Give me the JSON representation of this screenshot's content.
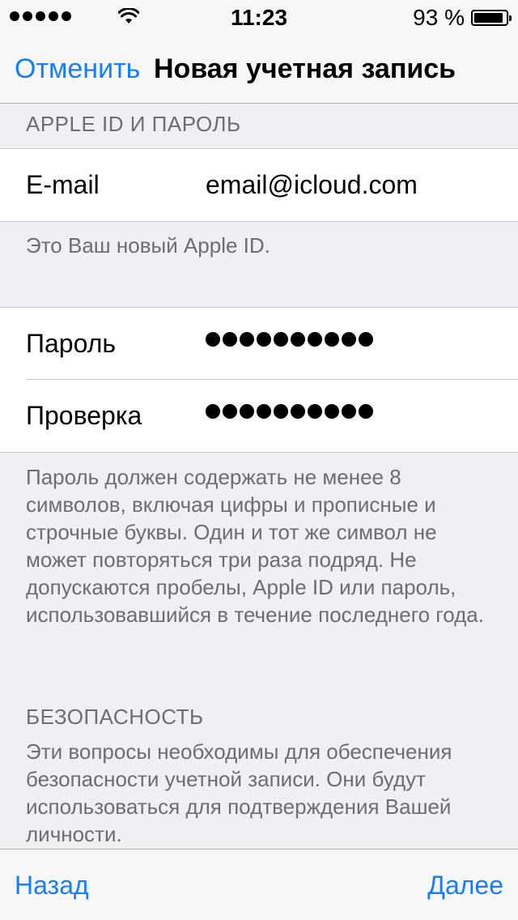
{
  "status_bar": {
    "time": "11:23",
    "battery_percent": "93 %",
    "battery_level": 0.93
  },
  "nav": {
    "cancel_label": "Отменить",
    "title": "Новая учетная запись"
  },
  "sections": {
    "apple_id_header": "APPLE ID И ПАРОЛЬ",
    "email_label": "E-mail",
    "email_value": "email@icloud.com",
    "apple_id_note": "Это Ваш новый Apple ID.",
    "password_label": "Пароль",
    "verify_label": "Проверка",
    "password_note": "Пароль должен содержать не менее 8 символов, включая цифры и прописные и строчные буквы. Один и тот же символ не может повторяться три раза подряд. Не допускаются пробелы, Apple ID или пароль, использовавшийся в течение последнего года.",
    "security_header": "БЕЗОПАСНОСТЬ",
    "security_note": "Эти вопросы необходимы для обеспечения безопасности учетной записи. Они будут использоваться для подтверждения Вашей личности."
  },
  "toolbar": {
    "back_label": "Назад",
    "next_label": "Далее"
  },
  "colors": {
    "accent": "#157efb",
    "background": "#efeff4"
  }
}
